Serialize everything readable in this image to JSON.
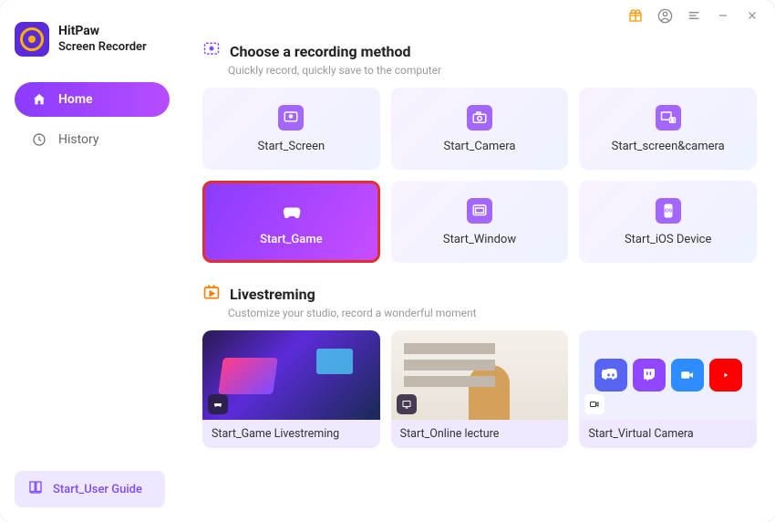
{
  "app": {
    "name": "HitPaw",
    "subtitle": "Screen Recorder"
  },
  "sidebar": {
    "items": [
      {
        "label": "Home",
        "icon": "home-icon",
        "active": true
      },
      {
        "label": "History",
        "icon": "history-icon",
        "active": false
      }
    ],
    "guide_label": "Start_User Guide"
  },
  "sections": {
    "record": {
      "title": "Choose a recording method",
      "subtitle": "Quickly record, quickly save to the computer",
      "cards": [
        {
          "label": "Start_Screen"
        },
        {
          "label": "Start_Camera"
        },
        {
          "label": "Start_screen&camera"
        },
        {
          "label": "Start_Game",
          "highlight": true
        },
        {
          "label": "Start_Window"
        },
        {
          "label": "Start_iOS Device"
        }
      ]
    },
    "stream": {
      "title": "Livestreming",
      "subtitle": "Customize your studio, record a wonderful moment",
      "cards": [
        {
          "label": "Start_Game Livestreming"
        },
        {
          "label": "Start_Online lecture"
        },
        {
          "label": "Start_Virtual Camera"
        }
      ]
    }
  }
}
